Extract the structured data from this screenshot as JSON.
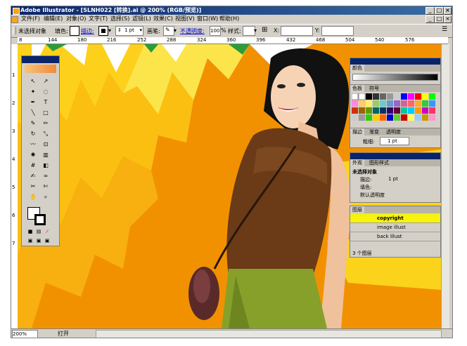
{
  "window": {
    "title": "Adobe Illustrator - [SLNH022 [转换].ai @ 200% (RGB/预览)]"
  },
  "menu": [
    "文件(F)",
    "编辑(E)",
    "对象(O)",
    "文字(T)",
    "选择(S)",
    "滤镜(L)",
    "效果(C)",
    "视图(V)",
    "窗口(W)",
    "帮助(H)"
  ],
  "control_bar": {
    "no_selection": "未选择对象",
    "fill_label": "填色:",
    "stroke_label": "描边:",
    "stroke_width": "1 pt",
    "brush_label": "画笔:",
    "opacity_label": "不透明度:",
    "opacity_value": "100",
    "opacity_unit": "%",
    "style_label": "样式:",
    "x_label": "X:",
    "y_label": "Y:"
  },
  "ruler_ticks": [
    "8",
    "144",
    "180",
    "216",
    "252",
    "288",
    "324",
    "360",
    "396",
    "432",
    "468",
    "504",
    "540",
    "576"
  ],
  "panels": {
    "color": {
      "tab": "颜色"
    },
    "swatches": {
      "tabs": [
        "色板",
        "符号"
      ]
    },
    "stroke": {
      "tabs": [
        "描边",
        "渐变",
        "透明度"
      ],
      "weight_label": "粗细:",
      "weight_value": "1 pt"
    },
    "appearance": {
      "tabs": [
        "外观",
        "图形样式"
      ],
      "title": "未选择对象",
      "stroke_row": "描边:",
      "stroke_value": "1 pt",
      "fill_row": "填色:",
      "opacity_row": "默认透明度"
    },
    "layers": {
      "tabs": [
        "图层"
      ],
      "items": [
        "copyright",
        "image illust",
        "back illust"
      ],
      "footer": "3 个图层"
    }
  },
  "status": {
    "zoom": "200%",
    "label": "打开"
  },
  "colors": {
    "titlebar": "#0a246a",
    "selected_layer": "#f7f30a"
  }
}
